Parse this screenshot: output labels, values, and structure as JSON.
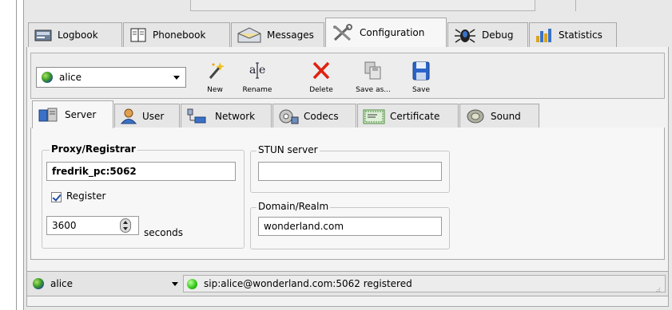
{
  "main_tabs": [
    {
      "label": "Logbook",
      "active": false,
      "icon": "logbook-icon"
    },
    {
      "label": "Phonebook",
      "active": false,
      "icon": "phonebook-icon"
    },
    {
      "label": "Messages",
      "active": false,
      "icon": "messages-icon"
    },
    {
      "label": "Configuration",
      "active": true,
      "icon": "configuration-icon"
    },
    {
      "label": "Debug",
      "active": false,
      "icon": "debug-icon"
    },
    {
      "label": "Statistics",
      "active": false,
      "icon": "statistics-icon"
    }
  ],
  "toolbar": {
    "account": "alice",
    "new_label": "New",
    "rename_label": "Rename",
    "delete_label": "Delete",
    "save_as_label": "Save as...",
    "save_label": "Save"
  },
  "sub_tabs": [
    {
      "label": "Server",
      "active": true,
      "icon": "server-icon"
    },
    {
      "label": "User",
      "active": false,
      "icon": "user-icon"
    },
    {
      "label": "Network",
      "active": false,
      "icon": "network-icon"
    },
    {
      "label": "Codecs",
      "active": false,
      "icon": "codecs-icon"
    },
    {
      "label": "Certificate",
      "active": false,
      "icon": "certificate-icon"
    },
    {
      "label": "Sound",
      "active": false,
      "icon": "sound-icon"
    }
  ],
  "server": {
    "proxy_title": "Proxy/Registrar",
    "proxy_value": "fredrik_pc:5062",
    "register_label": "Register",
    "register_checked": true,
    "expiry_value": "3600",
    "seconds_label": "seconds",
    "stun_title": "STUN server",
    "stun_value": "",
    "domain_title": "Domain/Realm",
    "domain_value": "wonderland.com"
  },
  "status": {
    "account": "alice",
    "text": "sip:alice@wonderland.com:5062 registered"
  },
  "colors": {
    "accent_blue": "#1f4da6",
    "delete_red": "#e02010",
    "status_green": "#35c81a"
  }
}
